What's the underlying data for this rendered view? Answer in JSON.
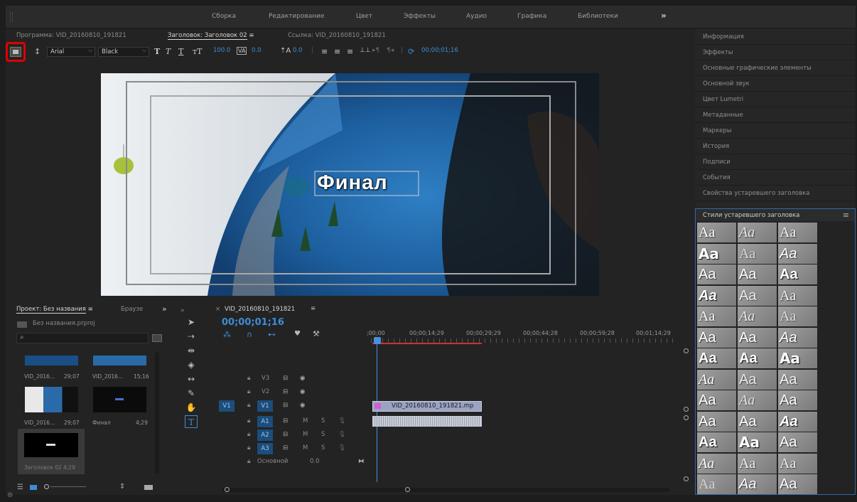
{
  "workspaces": [
    "Сборка",
    "Редактирование",
    "Цвет",
    "Эффекты",
    "Аудио",
    "Графика",
    "Библиотеки"
  ],
  "workspace_more": "»",
  "program_monitor": {
    "tabs": [
      {
        "label": "Программа: VID_20160810_191821",
        "active": false
      },
      {
        "label": "Заголовок: Заголовок 02",
        "active": true
      },
      {
        "label": "Ссылка: VID_20160810_191821",
        "active": false
      }
    ],
    "tab_menu": "≡",
    "font_family": "Arial",
    "font_style": "Black",
    "font_size": "100.0",
    "kerning": "0.0",
    "leading": "0.0",
    "timecode": "00;00;01;16",
    "title_text": "Финал"
  },
  "right_panels": [
    "Информация",
    "Эффекты",
    "Основные графические элементы",
    "Основной звук",
    "Цвет Lumetri",
    "Метаданные",
    "Маркеры",
    "История",
    "Подписи",
    "События",
    "Свойства устаревшего заголовка"
  ],
  "styles_panel": {
    "title": "Стили устаревшего заголовка",
    "menu": "≡",
    "swatch_text": "Aa"
  },
  "project": {
    "tab_label": "Проект: Без названия",
    "tab_menu": "≡",
    "browser_tab": "Браузе",
    "more": "»",
    "file": "Без названия.prproj",
    "items": [
      {
        "name": "VID_2016...",
        "duration": "29;07"
      },
      {
        "name": "VID_2016...",
        "duration": "15;16"
      },
      {
        "name": "VID_2016...",
        "duration": "29;07"
      },
      {
        "name": "Финал",
        "duration": "4;29"
      },
      {
        "name": "Заголовок 02",
        "duration": "4;29"
      }
    ]
  },
  "timeline": {
    "close": "×",
    "sequence": "VID_20160810_191821",
    "menu": "≡",
    "timecode": "00;00;01;16",
    "ruler": [
      ";00;00",
      "00;00;14;29",
      "00;00;29;29",
      "00;00;44;28",
      "00;00;59;28",
      "00;01;14;29"
    ],
    "video_tracks": [
      "V3",
      "V2",
      "V1"
    ],
    "audio_tracks": [
      "A1",
      "A2",
      "A3"
    ],
    "source_patch": "V1",
    "master_label": "Основной",
    "master_value": "0.0",
    "clip_label": "VID_20160810_191821.mp",
    "m_label": "M",
    "s_label": "S"
  },
  "colors": {
    "accent": "#3d8dd6",
    "highlight": "#e00000",
    "track_button": "#1d4d7a",
    "playhead": "#4a8fe0"
  }
}
